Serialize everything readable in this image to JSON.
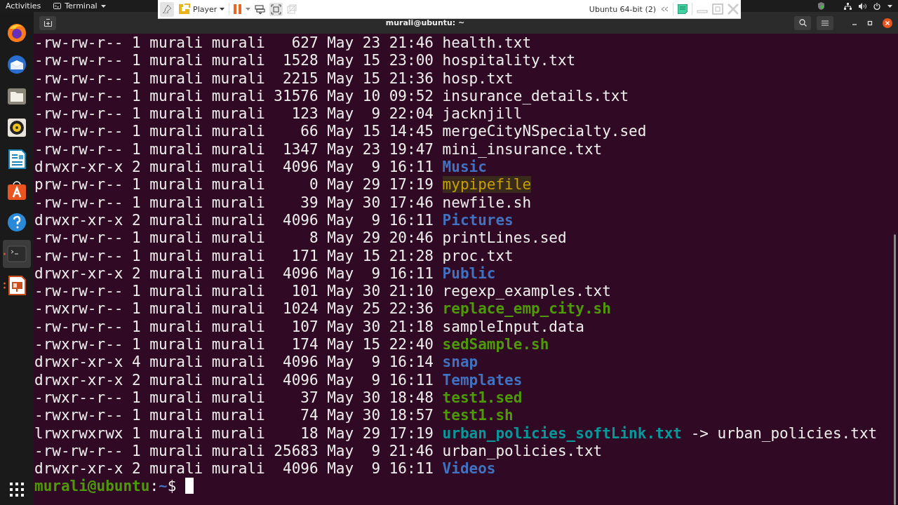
{
  "top_bar": {
    "activities": "Activities",
    "app_menu": "Terminal"
  },
  "vm_toolbar": {
    "player": "Player",
    "vm_name": "Ubuntu 64-bit (2)"
  },
  "dock": [
    {
      "kind": "firefox",
      "selected": false
    },
    {
      "kind": "thunderbird",
      "selected": false
    },
    {
      "kind": "files",
      "selected": false
    },
    {
      "kind": "rhythmbox",
      "selected": false
    },
    {
      "kind": "writer",
      "selected": false
    },
    {
      "kind": "software",
      "selected": false
    },
    {
      "kind": "help",
      "selected": false
    },
    {
      "kind": "terminal",
      "selected": true,
      "running": true,
      "multiple_windows": false
    },
    {
      "kind": "impress",
      "selected": false,
      "running": true,
      "multiple_windows": true
    }
  ],
  "terminal": {
    "title": "murali@ubuntu: ~",
    "lines": [
      {
        "info": "-rw-rw-r-- 1 murali murali   627 May 23 21:46",
        "name": "health.txt",
        "kind": "file"
      },
      {
        "info": "-rw-rw-r-- 1 murali murali  1528 May 15 23:00",
        "name": "hospitality.txt",
        "kind": "file"
      },
      {
        "info": "-rw-rw-r-- 1 murali murali  2215 May 15 21:36",
        "name": "hosp.txt",
        "kind": "file"
      },
      {
        "info": "-rw-rw-r-- 1 murali murali 31576 May 10 09:52",
        "name": "insurance_details.txt",
        "kind": "file"
      },
      {
        "info": "-rw-rw-r-- 1 murali murali   123 May  9 22:04",
        "name": "jacknjill",
        "kind": "file"
      },
      {
        "info": "-rw-rw-r-- 1 murali murali    66 May 15 14:45",
        "name": "mergeCityNSpecialty.sed",
        "kind": "file"
      },
      {
        "info": "-rw-rw-r-- 1 murali murali  1347 May 23 19:47",
        "name": "mini_insurance.txt",
        "kind": "file"
      },
      {
        "info": "drwxr-xr-x 2 murali murali  4096 May  9 16:11",
        "name": "Music",
        "kind": "dir"
      },
      {
        "info": "prw-rw-r-- 1 murali murali     0 May 29 17:19",
        "name": "mypipefile",
        "kind": "pipe"
      },
      {
        "info": "-rw-rw-r-- 1 murali murali    39 May 30 17:46",
        "name": "newfile.sh",
        "kind": "file"
      },
      {
        "info": "drwxr-xr-x 2 murali murali  4096 May  9 16:11",
        "name": "Pictures",
        "kind": "dir"
      },
      {
        "info": "-rw-rw-r-- 1 murali murali     8 May 29 20:46",
        "name": "printLines.sed",
        "kind": "file"
      },
      {
        "info": "-rw-rw-r-- 1 murali murali   171 May 15 21:28",
        "name": "proc.txt",
        "kind": "file"
      },
      {
        "info": "drwxr-xr-x 2 murali murali  4096 May  9 16:11",
        "name": "Public",
        "kind": "dir"
      },
      {
        "info": "-rw-rw-r-- 1 murali murali   101 May 30 21:10",
        "name": "regexp_examples.txt",
        "kind": "file"
      },
      {
        "info": "-rwxrw-r-- 1 murali murali  1024 May 25 22:36",
        "name": "replace_emp_city.sh",
        "kind": "exec"
      },
      {
        "info": "-rw-rw-r-- 1 murali murali   107 May 30 21:18",
        "name": "sampleInput.data",
        "kind": "file"
      },
      {
        "info": "-rwxrw-r-- 1 murali murali   174 May 15 22:40",
        "name": "sedSample.sh",
        "kind": "exec"
      },
      {
        "info": "drwxr-xr-x 4 murali murali  4096 May  9 16:14",
        "name": "snap",
        "kind": "dir"
      },
      {
        "info": "drwxr-xr-x 2 murali murali  4096 May  9 16:11",
        "name": "Templates",
        "kind": "dir"
      },
      {
        "info": "-rwxr--r-- 1 murali murali    37 May 30 18:48",
        "name": "test1.sed",
        "kind": "exec"
      },
      {
        "info": "-rwxrw-r-- 1 murali murali    74 May 30 18:57",
        "name": "test1.sh",
        "kind": "exec"
      },
      {
        "info": "lrwxrwxrwx 1 murali murali    18 May 29 17:19",
        "name": "urban_policies_softLink.txt",
        "kind": "link",
        "arrow": "->",
        "target": "urban_policies.txt"
      },
      {
        "info": "-rw-rw-r-- 1 murali murali 25683 May  9 21:46",
        "name": "urban_policies.txt",
        "kind": "file"
      },
      {
        "info": "drwxr-xr-x 2 murali murali  4096 May  9 16:11",
        "name": "Videos",
        "kind": "dir"
      }
    ],
    "prompt": {
      "user_host": "murali@ubuntu",
      "separator": ":",
      "path": "~",
      "symbol": "$"
    }
  }
}
